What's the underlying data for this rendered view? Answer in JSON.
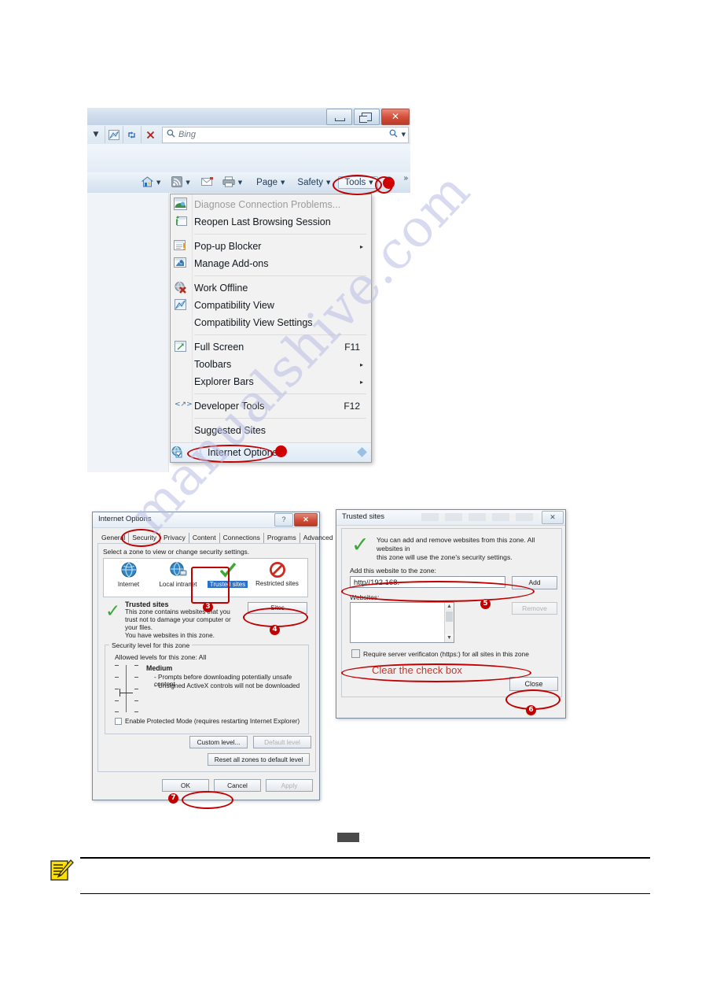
{
  "watermark": {
    "text": "manualshive.com"
  },
  "browser": {
    "window_buttons": {
      "minimize": "minimize-button",
      "restore": "restore-button",
      "close": "✕"
    },
    "address_bar": {
      "caret": "▼",
      "compat_icon": "compatibility-view-icon",
      "refresh_icon": "↻",
      "stop_icon": "✕"
    },
    "search_box": {
      "placeholder": "Bing",
      "magnifier": "⚲",
      "right_magnifier": "⚲",
      "right_caret": "▼"
    },
    "command_bar": {
      "home_icon": "home-icon",
      "feeds_icon": "rss-feed-icon",
      "mail_icon": "mail-icon",
      "print_icon": "printer-icon",
      "caret": "▼",
      "page_label": "Page",
      "safety_label": "Safety",
      "tools_label": "Tools",
      "help_icon": "help-icon",
      "overflow": "»"
    }
  },
  "tools_menu": {
    "items": [
      {
        "label": "Diagnose Connection Problems...",
        "icon": "diagnose-icon",
        "shortcut": "",
        "arrow": "",
        "disabled": true
      },
      {
        "label": "Reopen Last Browsing Session",
        "icon": "reopen-session-icon",
        "shortcut": "",
        "arrow": "",
        "disabled": false
      },
      {
        "label": "Pop-up Blocker",
        "icon": "popup-blocker-icon",
        "shortcut": "",
        "arrow": "▸",
        "disabled": false
      },
      {
        "label": "Manage Add-ons",
        "icon": "manage-addons-icon",
        "shortcut": "",
        "arrow": "",
        "disabled": false
      },
      {
        "label": "Work Offline",
        "icon": "work-offline-icon",
        "shortcut": "",
        "arrow": "",
        "disabled": false
      },
      {
        "label": "Compatibility View",
        "icon": "compatibility-view-icon",
        "shortcut": "",
        "arrow": "",
        "disabled": false
      },
      {
        "label": "Compatibility View Settings",
        "icon": "",
        "shortcut": "",
        "arrow": "",
        "disabled": false
      },
      {
        "label": "Full Screen",
        "icon": "full-screen-icon",
        "shortcut": "F11",
        "arrow": "",
        "disabled": false
      },
      {
        "label": "Toolbars",
        "icon": "",
        "shortcut": "",
        "arrow": "▸",
        "disabled": false
      },
      {
        "label": "Explorer Bars",
        "icon": "",
        "shortcut": "",
        "arrow": "▸",
        "disabled": false
      },
      {
        "label": "Developer Tools",
        "icon": "developer-tools-icon",
        "shortcut": "F12",
        "arrow": "",
        "disabled": false
      },
      {
        "label": "Suggested Sites",
        "icon": "",
        "shortcut": "",
        "arrow": "",
        "disabled": false
      },
      {
        "label": "Internet Options",
        "icon": "internet-options-icon",
        "shortcut": "",
        "arrow": "",
        "disabled": false
      }
    ]
  },
  "internet_options": {
    "title": "Internet Options",
    "help_glyph": "?",
    "close_glyph": "✕",
    "tabs": [
      {
        "label": "General"
      },
      {
        "label": "Security"
      },
      {
        "label": "Privacy"
      },
      {
        "label": "Content"
      },
      {
        "label": "Connections"
      },
      {
        "label": "Programs"
      },
      {
        "label": "Advanced"
      }
    ],
    "selected_tab": "Security",
    "zone_hint": "Select a zone to view or change security settings.",
    "zones": [
      {
        "label": "Internet",
        "icon": "globe-icon"
      },
      {
        "label": "Local intranet",
        "icon": "globe-network-icon"
      },
      {
        "label": "Trusted sites",
        "icon": "green-check-icon"
      },
      {
        "label": "Restricted sites",
        "icon": "no-entry-icon"
      }
    ],
    "selected_zone": "Trusted sites",
    "zone_detail": {
      "title": "Trusted sites",
      "line1": "This zone contains websites that you",
      "line2": "trust not to damage your computer or",
      "line3": "your files.",
      "line4": "You have websites in this zone."
    },
    "sites_button": "Sites",
    "security_level": {
      "legend": "Security level for this zone",
      "allowed": "Allowed levels for this zone: All",
      "level_name": "Medium",
      "bullet1": "- Prompts before downloading potentially unsafe content",
      "bullet2": "- Unsigned ActiveX controls will not be downloaded",
      "protected_mode": "Enable Protected Mode (requires restarting Internet Explorer)",
      "custom_level": "Custom level...",
      "default_level": "Default level",
      "reset_all": "Reset all zones to default level"
    },
    "footer_buttons": {
      "ok": "OK",
      "cancel": "Cancel",
      "apply": "Apply"
    }
  },
  "trusted_sites": {
    "title": "Trusted sites",
    "close_glyph": "✕",
    "info_line1": "You can add and remove websites from this zone. All websites in",
    "info_line2": "this zone will use the zone's security settings.",
    "add_label": "Add this website to the zone:",
    "website_value": "http//192.168.",
    "add_button": "Add",
    "websites_label": "Websites:",
    "websites": [],
    "remove_button": "Remove",
    "require_verification": "Require server verificaton (https:) for all sites in this zone",
    "require_verification_checked": false,
    "annotation": "Clear the check box",
    "close_button": "Close",
    "scroll_up": "▲",
    "scroll_down": "▼"
  },
  "steps": {
    "s3": "3",
    "s4": "4",
    "s5": "5",
    "s6": "6",
    "s7": "7"
  },
  "colors": {
    "annotation_red": "#c00000",
    "note_red": "#c0392b",
    "green_check": "#3aa836",
    "selection_blue": "#2a6fc9"
  },
  "footer": {
    "note_icon": "note-pencil-icon"
  }
}
